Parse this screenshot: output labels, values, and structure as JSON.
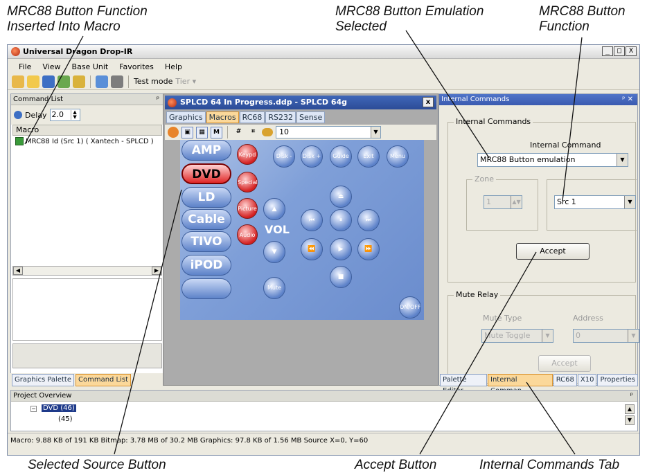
{
  "callouts": {
    "top_left_1": "MRC88 Button Function",
    "top_left_2": "Inserted Into Macro",
    "top_mid_1": "MRC88 Button Emulation",
    "top_mid_2": "Selected",
    "top_right_1": "MRC88 Button",
    "top_right_2": "Function",
    "bottom_left": "Selected Source Button",
    "bottom_mid": "Accept Button",
    "bottom_right": "Internal Commands Tab"
  },
  "window": {
    "title": "Universal Dragon Drop-IR",
    "min": "_",
    "max": "□",
    "close": "X"
  },
  "menu": [
    "File",
    "View",
    "Base Unit",
    "Favorites",
    "Help"
  ],
  "toolbar": {
    "test_mode": "Test mode",
    "tier": "Tier ▾"
  },
  "left_panel": {
    "title": "Command List",
    "pin": "ᵖ",
    "delay_label": "Delay",
    "delay_value": "2.0",
    "macro_header": "Macro",
    "macro_item": "MRC88 Id (Src 1) ( Xantech - SPLCD )",
    "tabs": [
      "Graphics Palette",
      "Command List"
    ]
  },
  "doc": {
    "title": "SPLCD 64 In Progress.ddp - SPLCD 64g",
    "close": "x",
    "tabs": [
      "Graphics",
      "Macros",
      "RC68",
      "RS232",
      "Sense"
    ],
    "active_tab": "Macros",
    "zoom_value": "10",
    "tool_m": "M",
    "source_buttons": [
      "AMP",
      "DVD",
      "LD",
      "Cable",
      "TIVO",
      "iPOD",
      ""
    ],
    "red_buttons": [
      "Keypd",
      "Special",
      "Picture",
      "Audio"
    ],
    "top_round": [
      "Disk -",
      "Disk +",
      "Guide",
      "Exit",
      "Menu"
    ],
    "vol_label": "VOL",
    "mute": "Mute",
    "onoff": "ON/OFF"
  },
  "right_panel": {
    "title": "Internal Commands",
    "header_ctrls": "ᵖ ✕",
    "group_label": "Internal Commands",
    "internal_command_label": "Internal Command",
    "internal_command_value": "MRC88 Button emulation",
    "zone_label": "Zone",
    "zone_value": "1",
    "src_value": "Src 1",
    "accept": "Accept",
    "mute_group": "Mute Relay",
    "mute_type_label": "Mute Type",
    "address_label": "Address",
    "mute_type_value": "Mute Toggle",
    "address_value": "0",
    "accept_disabled": "Accept",
    "tabs": [
      "Palette Editor",
      "Internal Comman...",
      "RC68",
      "X10",
      "Properties"
    ],
    "active_tab": "Internal Comman..."
  },
  "project": {
    "title": "Project Overview",
    "pin": "ᵖ",
    "node": "DVD (46)",
    "child": "(45)"
  },
  "status": "Macro: 9.88 KB of 191 KB  Bitmap: 3.78 MB of 30.2 MB  Graphics: 97.8 KB of 1.56 MB  Source  X=0, Y=60"
}
